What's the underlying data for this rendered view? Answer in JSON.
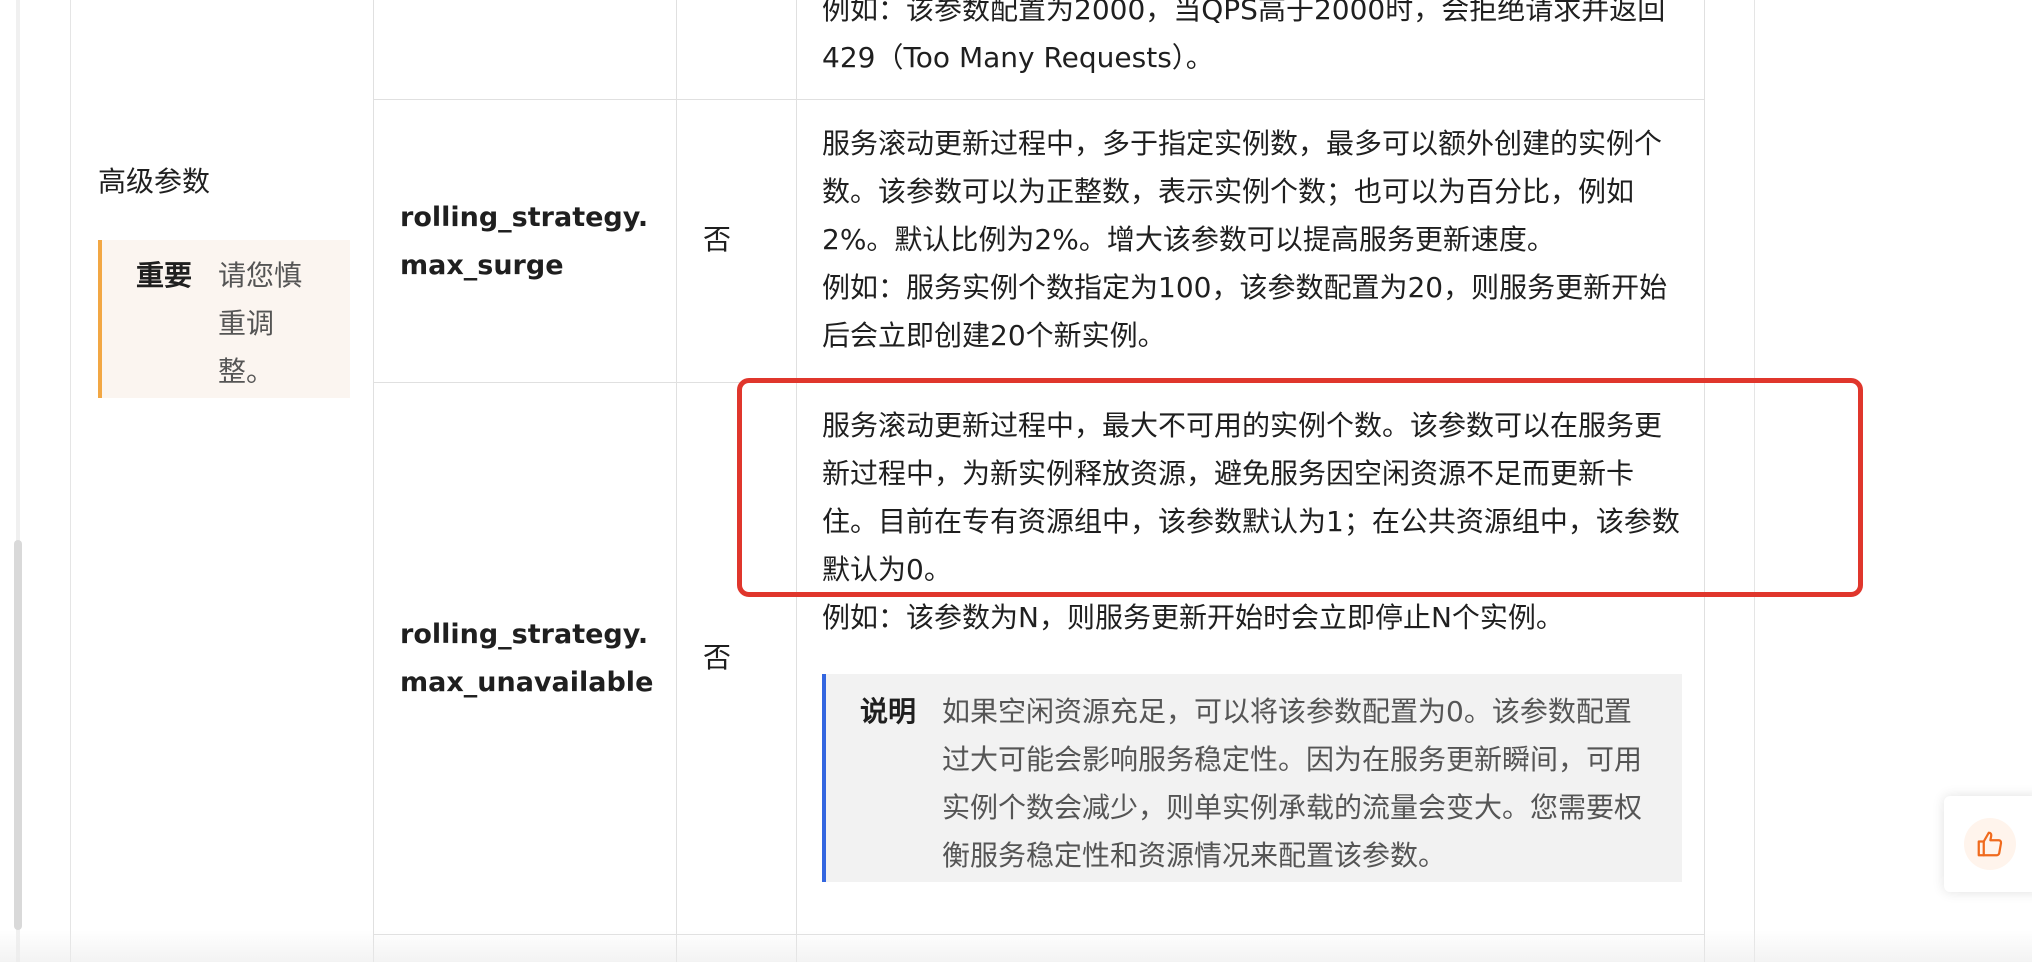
{
  "section": {
    "advanced_params_label": "高级参数"
  },
  "important": {
    "title": "重要",
    "text": "请您慎重调整。"
  },
  "rows": {
    "prev": {
      "desc_tail": "例如：该参数配置为2000，当QPS高于2000时，会拒绝请求并返回429（Too Many Requests）。"
    },
    "max_surge": {
      "param": "rolling_strategy.max_surge",
      "required": "否",
      "desc_line1": "服务滚动更新过程中，多于指定实例数，最多可以额外创建的实例个数。该参数可以为正整数，表示实例个数；也可以为百分比，例如2%。默认比例为2%。增大该参数可以提高服务更新速度。",
      "desc_line2": "例如：服务实例个数指定为100，该参数配置为20，则服务更新开始后会立即创建20个新实例。"
    },
    "max_unavailable": {
      "param": "rolling_strategy.max_unavailable",
      "required": "否",
      "desc_line1": "服务滚动更新过程中，最大不可用的实例个数。该参数可以在服务更新过程中，为新实例释放资源，避免服务因空闲资源不足而更新卡住。目前在专有资源组中，该参数默认为1；在公共资源组中，该参数默认为0。",
      "desc_line2": "例如：该参数为N，则服务更新开始时会立即停止N个实例。",
      "note_title": "说明",
      "note_text": "如果空闲资源充足，可以将该参数配置为0。该参数配置过大可能会影响服务稳定性。因为在服务更新瞬间，可用实例个数会减少，则单实例承载的流量会变大。您需要权衡服务稳定性和资源情况来配置该参数。"
    }
  },
  "colors": {
    "highlight": "#e0362c",
    "important_accent": "#f2a744",
    "note_accent": "#3366e0",
    "like": "#f06a1d"
  },
  "icons": {
    "like": "thumbs-up-icon"
  }
}
